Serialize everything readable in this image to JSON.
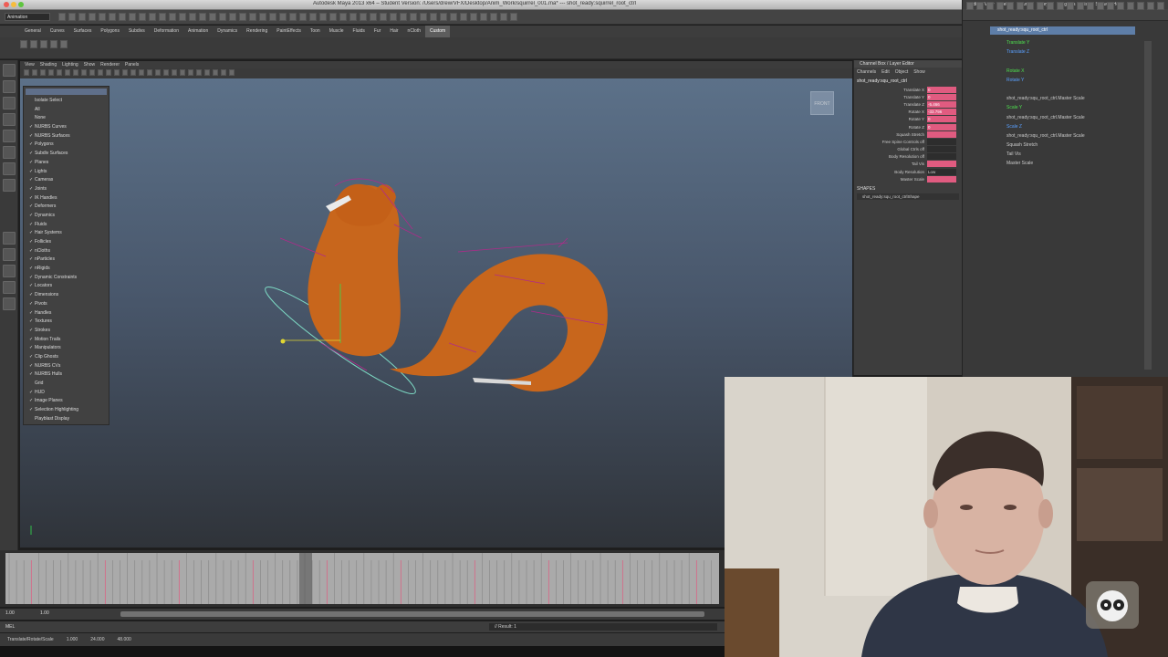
{
  "window": {
    "title": "Autodesk Maya 2013 x64 – Student Version: /Users/drew/VFX/Desktop/Anim_Work/squirrel_001.ma*  ---  shot_ready:squirrel_root_ctrl"
  },
  "statusline": {
    "mode": "Animation"
  },
  "shelf_tabs": [
    "General",
    "Curves",
    "Surfaces",
    "Polygons",
    "Subdivs",
    "Deformation",
    "Animation",
    "Dynamics",
    "Rendering",
    "PaintEffects",
    "Toon",
    "Muscle",
    "Fluids",
    "Fur",
    "Hair",
    "nCloth",
    "Custom"
  ],
  "active_shelf": "Custom",
  "viewport_menu": [
    "View",
    "Shading",
    "Lighting",
    "Show",
    "Renderer",
    "Panels"
  ],
  "viewcube_label": "FRONT",
  "show_menu": {
    "items": [
      {
        "label": "Isolate Select",
        "checked": false
      },
      {
        "label": "All",
        "checked": false
      },
      {
        "label": "None",
        "checked": false
      },
      {
        "label": "NURBS Curves",
        "checked": true
      },
      {
        "label": "NURBS Surfaces",
        "checked": true
      },
      {
        "label": "Polygons",
        "checked": true
      },
      {
        "label": "Subdiv Surfaces",
        "checked": true
      },
      {
        "label": "Planes",
        "checked": true
      },
      {
        "label": "Lights",
        "checked": true
      },
      {
        "label": "Cameras",
        "checked": true
      },
      {
        "label": "Joints",
        "checked": true
      },
      {
        "label": "IK Handles",
        "checked": true
      },
      {
        "label": "Deformers",
        "checked": true
      },
      {
        "label": "Dynamics",
        "checked": true
      },
      {
        "label": "Fluids",
        "checked": true
      },
      {
        "label": "Hair Systems",
        "checked": true
      },
      {
        "label": "Follicles",
        "checked": true
      },
      {
        "label": "nCloths",
        "checked": true
      },
      {
        "label": "nParticles",
        "checked": true
      },
      {
        "label": "nRigids",
        "checked": true
      },
      {
        "label": "Dynamic Constraints",
        "checked": true
      },
      {
        "label": "Locators",
        "checked": true
      },
      {
        "label": "Dimensions",
        "checked": true
      },
      {
        "label": "Pivots",
        "checked": true
      },
      {
        "label": "Handles",
        "checked": true
      },
      {
        "label": "Textures",
        "checked": true
      },
      {
        "label": "Strokes",
        "checked": true
      },
      {
        "label": "Motion Trails",
        "checked": true
      },
      {
        "label": "Manipulators",
        "checked": true
      },
      {
        "label": "Clip Ghosts",
        "checked": true
      },
      {
        "label": "NURBS CVs",
        "checked": true
      },
      {
        "label": "NURBS Hulls",
        "checked": true
      },
      {
        "label": "Grid",
        "checked": false
      },
      {
        "label": "HUD",
        "checked": true
      },
      {
        "label": "Image Planes",
        "checked": true
      },
      {
        "label": "Selection Highlighting",
        "checked": true
      },
      {
        "label": "Playblast Display",
        "checked": false
      }
    ]
  },
  "channel_box": {
    "header": "Channel Box / Layer Editor",
    "tabs": [
      "Channels",
      "Edit",
      "Object",
      "Show"
    ],
    "object_name": "shot_ready:squ_root_ctrl",
    "channels": [
      {
        "label": "Translate X",
        "value": "0",
        "keyed": true
      },
      {
        "label": "Translate Y",
        "value": "0",
        "keyed": true
      },
      {
        "label": "Translate Z",
        "value": "-5.466",
        "keyed": true
      },
      {
        "label": "Rotate X",
        "value": "-33.796",
        "keyed": true
      },
      {
        "label": "Rotate Y",
        "value": "0",
        "keyed": true
      },
      {
        "label": "Rotate Z",
        "value": "0",
        "keyed": true
      },
      {
        "label": "Squash Stretch",
        "value": "",
        "keyed": true
      },
      {
        "label": "Free Spine Controls off",
        "value": "",
        "keyed": false
      },
      {
        "label": "Global Ctrls off",
        "value": "",
        "keyed": false
      },
      {
        "label": "Body Resolution off",
        "value": "",
        "keyed": false
      },
      {
        "label": "Tail Vis",
        "value": "",
        "keyed": true
      },
      {
        "label": "Body Resolution",
        "value": "Low",
        "keyed": false
      },
      {
        "label": "Master Scale",
        "value": "",
        "keyed": true
      }
    ],
    "shapes_title": "SHAPES",
    "shape_name": "shot_ready:squ_root_ctrlShape"
  },
  "node_window": {
    "menu": [
      "Edit",
      "View",
      "Select",
      "Curves",
      "Keys",
      "Tangents",
      "List",
      "Show",
      "Help"
    ],
    "selected": "shot_ready:squ_root_ctrl",
    "rows": [
      {
        "label": "Translate Y",
        "color": "#4ee04e"
      },
      {
        "label": "Translate Z",
        "color": "#5aa0ff"
      },
      {
        "label": "",
        "color": "#cccccc"
      },
      {
        "label": "Rotate X",
        "color": "#4ee04e"
      },
      {
        "label": "Rotate Y",
        "color": "#5aa0ff"
      },
      {
        "label": "",
        "color": "#cccccc"
      },
      {
        "label": "shot_ready:squ_root_ctrl.Master Scale",
        "color": "#cccccc"
      },
      {
        "label": "Scale Y",
        "color": "#4ee04e"
      },
      {
        "label": "shot_ready:squ_root_ctrl.Master Scale",
        "color": "#cccccc"
      },
      {
        "label": "Scale Z",
        "color": "#5aa0ff"
      },
      {
        "label": "shot_ready:squ_root_ctrl.Master Scale",
        "color": "#cccccc"
      },
      {
        "label": "Squash Stretch",
        "color": "#cccccc"
      },
      {
        "label": "Tail Vis",
        "color": "#cccccc"
      },
      {
        "label": "Master Scale",
        "color": "#cccccc"
      }
    ]
  },
  "time_range": {
    "start": "1.00",
    "inner_start": "1.00",
    "end_a": "1.000",
    "end_b": "24.000",
    "end_c": "48.000"
  },
  "command_line": {
    "language": "MEL",
    "result": "// Result: 1"
  },
  "help_line": [
    "Translate/Rotate/Scale",
    "1.000",
    "24.000",
    "48.000"
  ],
  "colors": {
    "keyed": "#e05b80",
    "viewport_top": "#5c7189",
    "viewport_bottom": "#2f3339",
    "squirrel": "#c8661c",
    "panel": "#3d3d3d"
  }
}
